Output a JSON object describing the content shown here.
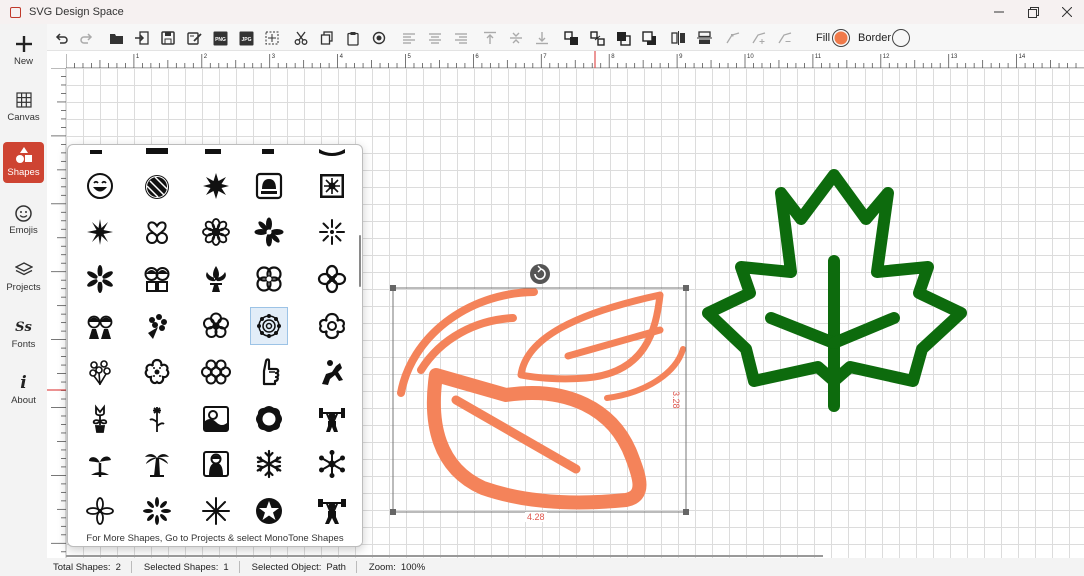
{
  "window": {
    "title": "SVG Design Space",
    "buttons": [
      "minimize",
      "maximize",
      "close"
    ]
  },
  "sidebar": {
    "items": [
      {
        "label": "New",
        "icon": "plus-icon",
        "active": false
      },
      {
        "label": "Canvas",
        "icon": "grid-icon",
        "active": false
      },
      {
        "label": "Shapes",
        "icon": "shapes-icon",
        "active": true
      },
      {
        "label": "Emojis",
        "icon": "smiley-icon",
        "active": false
      },
      {
        "label": "Projects",
        "icon": "layers-icon",
        "active": false
      },
      {
        "label": "Fonts",
        "icon": "fonts-icon",
        "active": false
      },
      {
        "label": "About",
        "icon": "info-icon",
        "active": false
      }
    ]
  },
  "toolbar": {
    "fill_label": "Fill",
    "border_label": "Border",
    "fill_color": "#f07a4a",
    "png_label": "PNG",
    "jpg_label": "JPG",
    "tools": [
      "undo",
      "redo",
      "open",
      "import",
      "save",
      "save-as",
      "export-png",
      "export-jpg",
      "select-all",
      "cut",
      "copy",
      "paste",
      "preview",
      "align-left",
      "align-center",
      "align-right",
      "align-top",
      "align-middle",
      "align-bottom",
      "group",
      "ungroup",
      "bring-to-front",
      "send-to-back",
      "flip-horizontal",
      "flip-vertical",
      "node-edit",
      "node-add",
      "node-remove"
    ]
  },
  "ruler": {
    "labels": [
      "1",
      "2",
      "3",
      "4",
      "5",
      "6",
      "7",
      "8",
      "9",
      "10",
      "11",
      "12",
      "13",
      "14"
    ]
  },
  "shapes_panel": {
    "footer": "For More Shapes, Go to Projects & select MonoTone Shapes",
    "rows": [
      [
        "smiley-face",
        "pumpkin",
        "eight-point-star",
        "photo-frame",
        "sunburst-square"
      ],
      [
        "spiky-star",
        "twin-hearts",
        "daisy",
        "pinwheel-flower",
        "starburst-lines"
      ],
      [
        "asterisk-flower",
        "kid-couple",
        "fleur-de-lis",
        "four-petal-flower",
        "clover-flower"
      ],
      [
        "two-girls",
        "flower-bouquet",
        "round-flower",
        "ornate-flower",
        "rounded-flower"
      ],
      [
        "flower-bunch",
        "blossom",
        "circle-flower",
        "hand-pointing",
        "rider"
      ],
      [
        "tulip-sprig",
        "sparkle-stem",
        "wave-frame",
        "scalloped-ring",
        "weightlifter"
      ],
      [
        "sprout",
        "palm-tree",
        "girl-portrait",
        "snowflake",
        "snowflake-ornate"
      ],
      [
        "propeller",
        "star-burst",
        "asterisk-star",
        "star-badge",
        "weightlifter-2"
      ]
    ],
    "selected": "ornate-flower"
  },
  "canvas": {
    "selection_width": "4.28",
    "selection_height": "3.28",
    "leaf_color": "#f4835a",
    "maple_color": "#0d6b0d"
  },
  "status": [
    {
      "label": "Total Shapes:",
      "value": "2"
    },
    {
      "label": "Selected Shapes:",
      "value": "1"
    },
    {
      "label": "Selected Object:",
      "value": "Path"
    },
    {
      "label": "Zoom:",
      "value": "100%"
    }
  ]
}
